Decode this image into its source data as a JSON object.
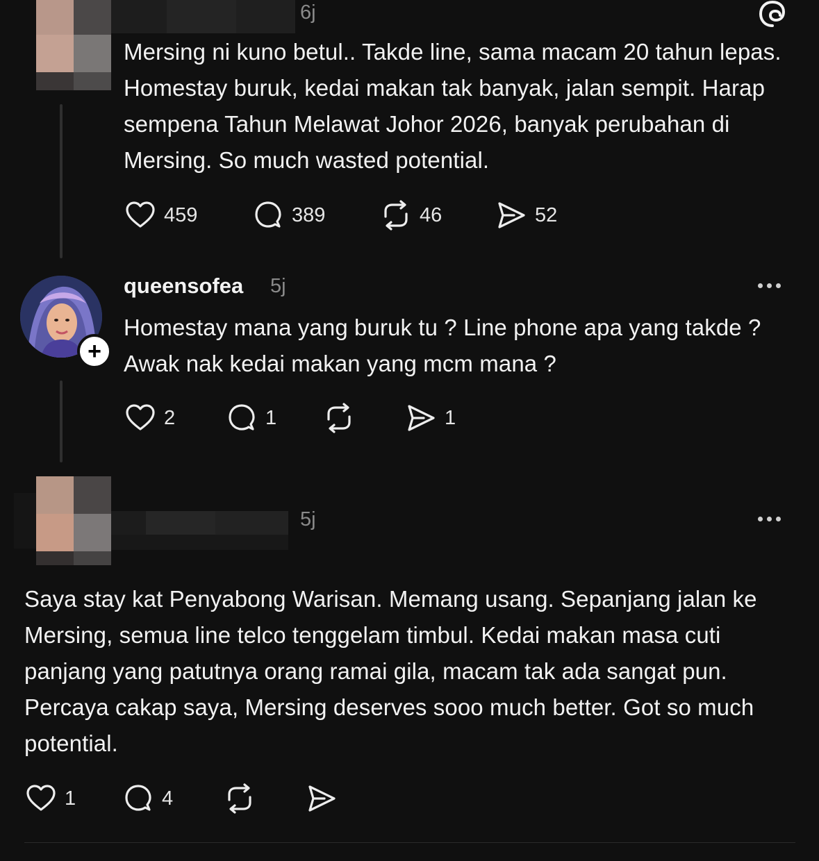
{
  "post1": {
    "time": "6j",
    "body": "Mersing ni kuno betul.. Takde line, sama macam 20 tahun lepas. Homestay buruk, kedai makan tak banyak, jalan sempit. Harap sempena Tahun Melawat Johor 2026, banyak perubahan di Mersing. So much wasted potential.",
    "likes": "459",
    "replies": "389",
    "reposts": "46",
    "shares": "52"
  },
  "post2": {
    "username": "queensofea",
    "time": "5j",
    "body": "Homestay mana yang buruk tu ? Line phone apa yang takde ? Awak nak kedai makan yang mcm mana ?",
    "likes": "2",
    "replies": "1",
    "reposts": "",
    "shares": "1",
    "follow_glyph": "+"
  },
  "post3": {
    "time": "5j",
    "body": "Saya stay kat Penyabong Warisan. Memang usang. Sepanjang jalan ke Mersing, semua line telco tenggelam timbul. Kedai makan masa cuti panjang yang patutnya orang ramai gila, macam tak ada sangat pun. Percaya cakap saya, Mersing deserves sooo much better. Got so much potential.",
    "likes": "1",
    "replies": "4",
    "reposts": "",
    "shares": ""
  },
  "icons": [
    "threads-logo-icon",
    "heart-icon",
    "reply-icon",
    "repost-icon",
    "share-icon",
    "more-options-icon",
    "follow-plus-icon"
  ],
  "colors": {
    "background": "#101010",
    "text": "#f2f2f2",
    "muted": "#8a8a8a",
    "thread_line": "#2f2f2f"
  }
}
